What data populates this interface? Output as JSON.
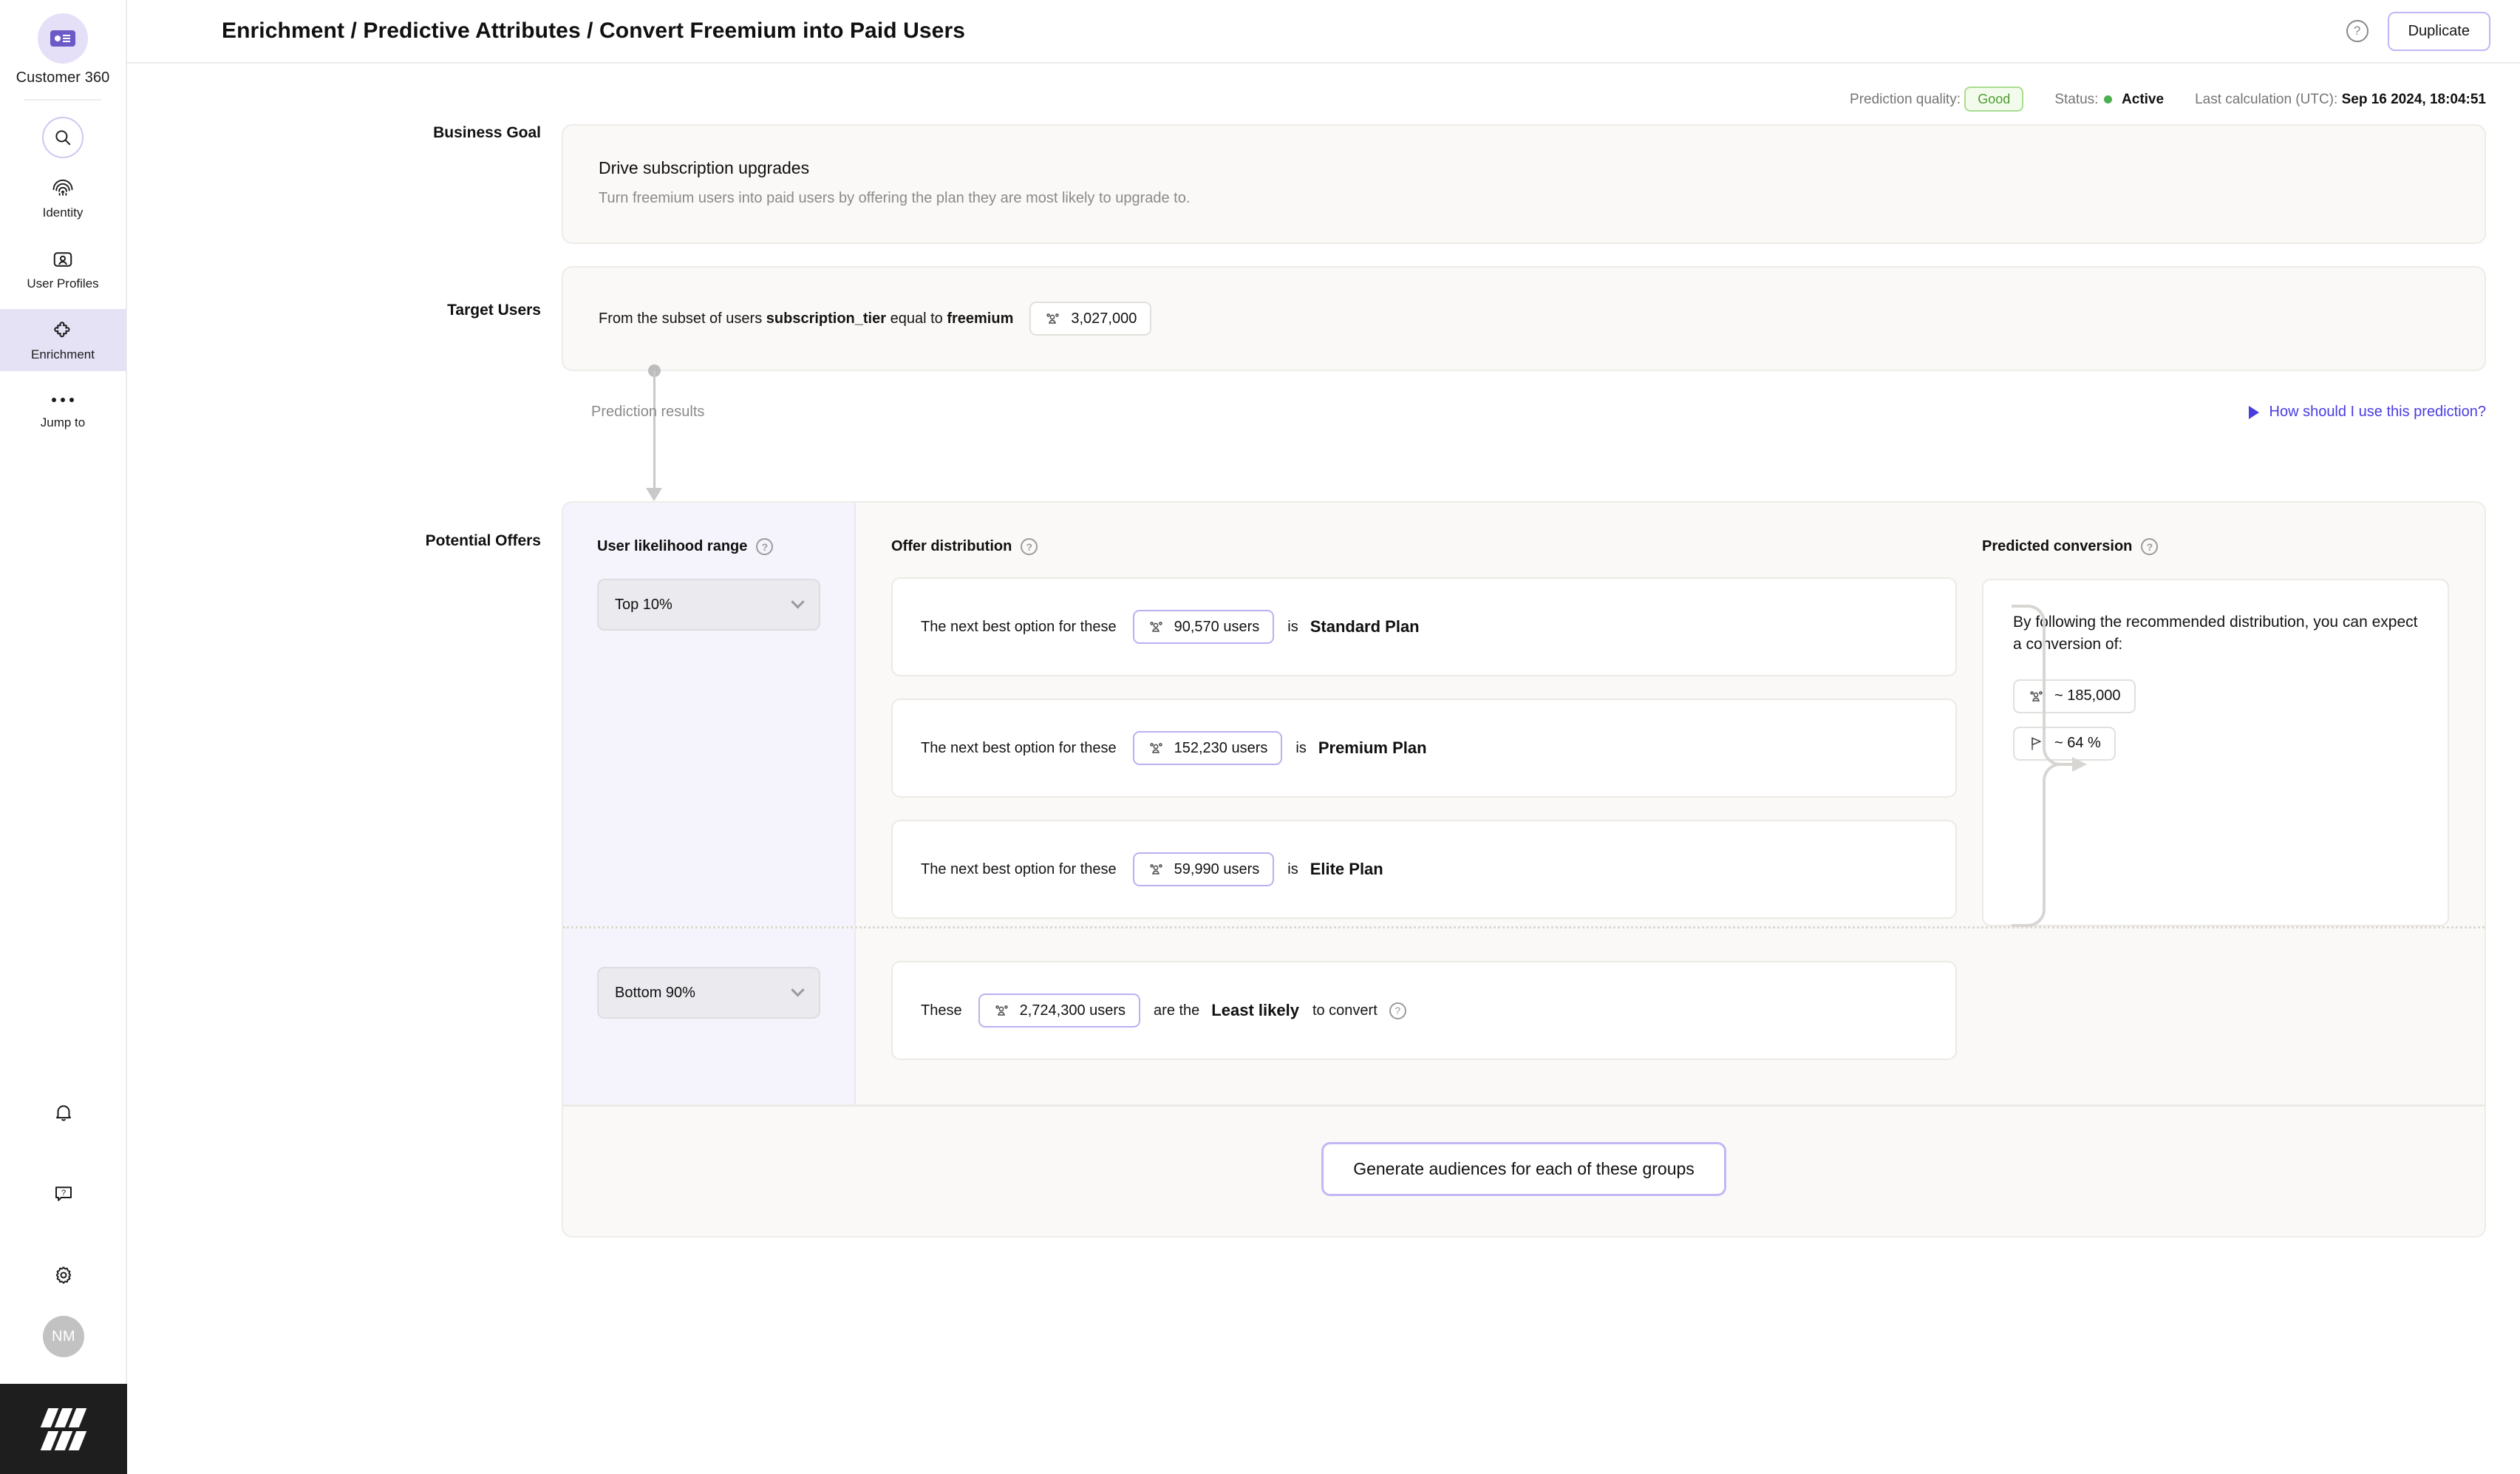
{
  "sidebar": {
    "brand": {
      "name": "Customer 360",
      "icon": "contact-card-icon"
    },
    "search": {
      "icon": "search-icon"
    },
    "items": [
      {
        "label": "Identity",
        "icon": "fingerprint-icon",
        "active": false
      },
      {
        "label": "User Profiles",
        "icon": "user-profile-icon",
        "active": false
      },
      {
        "label": "Enrichment",
        "icon": "puzzle-piece-icon",
        "active": true
      },
      {
        "label": "Jump to",
        "icon": "ellipsis-icon",
        "active": false
      }
    ],
    "bottom": {
      "notifications_icon": "bell-icon",
      "help_icon": "question-bubble-icon",
      "settings_icon": "gear-icon",
      "avatar_initials": "NM",
      "logo": "amplitude-logo"
    }
  },
  "header": {
    "title": "Enrichment / Predictive Attributes / Convert Freemium into Paid Users",
    "help_icon": "question-circle-icon",
    "duplicate_label": "Duplicate"
  },
  "meta": {
    "quality_label": "Prediction quality:",
    "quality_value": "Good",
    "status_label": "Status:",
    "status_value": "Active",
    "last_calc_label": "Last calculation (UTC):",
    "last_calc_value": "Sep 16 2024, 18:04:51"
  },
  "business_goal": {
    "section_label": "Business Goal",
    "title": "Drive subscription upgrades",
    "description": "Turn freemium users into paid users by offering the plan they are most likely to upgrade to."
  },
  "target_users": {
    "section_label": "Target Users",
    "prefix": "From the subset of users ",
    "attribute": "subscription_tier",
    "mid": " equal to ",
    "value": "freemium",
    "count": "3,027,000",
    "count_icon": "users-icon"
  },
  "prediction": {
    "results_label": "Prediction results",
    "link_label": "How should I use this prediction?",
    "link_icon": "play-triangle-icon"
  },
  "potential_offers": {
    "section_label": "Potential Offers",
    "likelihood_header": "User likelihood range",
    "likelihood_help_icon": "question-circle-icon",
    "offer_header": "Offer distribution",
    "offer_help_icon": "question-circle-icon",
    "conversion_header": "Predicted conversion",
    "conversion_help_icon": "question-circle-icon",
    "top_select_value": "Top 10%",
    "bottom_select_value": "Bottom 90%",
    "select_chevron_icon": "chevron-down-icon",
    "rows": [
      {
        "prefix": "The next best option for these",
        "count": "90,570 users",
        "is": "is",
        "plan": "Standard Plan",
        "icon": "users-icon"
      },
      {
        "prefix": "The next best option for these",
        "count": "152,230 users",
        "is": "is",
        "plan": "Premium Plan",
        "icon": "users-icon"
      },
      {
        "prefix": "The next best option for these",
        "count": "59,990 users",
        "is": "is",
        "plan": "Elite Plan",
        "icon": "users-icon"
      }
    ],
    "conversion": {
      "text": "By following the recommended distribution, you can expect a conversion of:",
      "users_value": "~ 185,000",
      "users_icon": "users-icon",
      "rate_value": "~ 64 %",
      "rate_icon": "flag-icon"
    },
    "bottom_row": {
      "these": "These",
      "count": "2,724,300 users",
      "mid": "are the",
      "emphasis": "Least likely",
      "suffix": "to convert",
      "icon": "users-icon",
      "help_icon": "question-circle-icon"
    },
    "generate_label": "Generate audiences for each of these groups"
  },
  "colors": {
    "accent_purple": "#6c5ac7",
    "link_blue": "#4a3ddf",
    "status_green": "#4caf50",
    "good_green": "#4f9b2f",
    "panel_bg": "#faf9f7",
    "likelihood_bg": "#f5f3fb"
  }
}
